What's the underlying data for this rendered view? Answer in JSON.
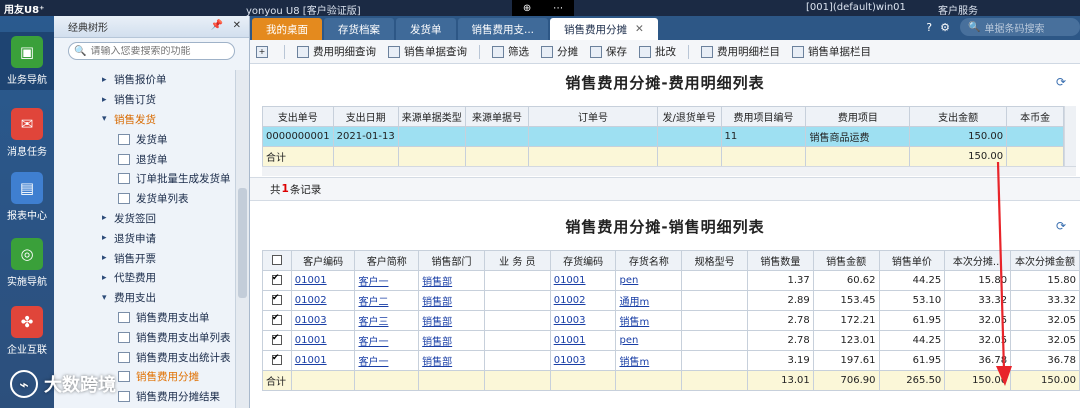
{
  "titlebar": {
    "brand": "用友U8⁺",
    "title": "yonyou U8 [客户验证版]",
    "account": "[001](default)win01",
    "service": "客户服务"
  },
  "iconbar": [
    {
      "label": "业务导航",
      "color": "#3aa03a",
      "glyph": "▣",
      "icon": "business-nav-icon"
    },
    {
      "label": "消息任务",
      "color": "#e0453a",
      "glyph": "✉",
      "icon": "message-icon"
    },
    {
      "label": "报表中心",
      "color": "#3f7fd0",
      "glyph": "▤",
      "icon": "report-icon"
    },
    {
      "label": "实施导航",
      "color": "#3aa03a",
      "glyph": "◎",
      "icon": "implement-nav-icon"
    },
    {
      "label": "企业互联",
      "color": "#e0453a",
      "glyph": "✤",
      "icon": "enterprise-icon"
    }
  ],
  "tree": {
    "header": "经典树形",
    "search_placeholder": "请输入您要搜索的功能",
    "items": [
      {
        "label": "销售报价单",
        "level": 1,
        "type": "arrow"
      },
      {
        "label": "销售订货",
        "level": 1,
        "type": "arrow"
      },
      {
        "label": "销售发货",
        "level": 1,
        "type": "open"
      },
      {
        "label": "发货单",
        "level": 2,
        "type": "doc"
      },
      {
        "label": "退货单",
        "level": 2,
        "type": "doc"
      },
      {
        "label": "订单批量生成发货单",
        "level": 2,
        "type": "doc"
      },
      {
        "label": "发货单列表",
        "level": 2,
        "type": "doc"
      },
      {
        "label": "发货签回",
        "level": 1,
        "type": "arrow"
      },
      {
        "label": "退货申请",
        "level": 1,
        "type": "arrow"
      },
      {
        "label": "销售开票",
        "level": 1,
        "type": "arrow"
      },
      {
        "label": "代垫费用",
        "level": 1,
        "type": "arrow"
      },
      {
        "label": "费用支出",
        "level": 1,
        "type": "open-plain"
      },
      {
        "label": "销售费用支出单",
        "level": 2,
        "type": "doc"
      },
      {
        "label": "销售费用支出单列表",
        "level": 2,
        "type": "doc"
      },
      {
        "label": "销售费用支出统计表",
        "level": 2,
        "type": "doc"
      },
      {
        "label": "销售费用分摊",
        "level": 2,
        "type": "doc-selected"
      },
      {
        "label": "销售费用分摊结果",
        "level": 2,
        "type": "doc"
      }
    ]
  },
  "tabs": [
    {
      "label": "我的桌面",
      "kind": "home"
    },
    {
      "label": "存货档案",
      "kind": "normal"
    },
    {
      "label": "发货单",
      "kind": "normal"
    },
    {
      "label": "销售费用支...",
      "kind": "normal"
    },
    {
      "label": "销售费用分摊",
      "kind": "active"
    }
  ],
  "header_search_placeholder": "单据条码搜索",
  "toolbar": [
    {
      "label": "费用明细查询",
      "icon": "search-doc-icon"
    },
    {
      "label": "销售单据查询",
      "icon": "search-doc-icon"
    },
    {
      "label": "筛选",
      "icon": "filter-icon"
    },
    {
      "label": "分摊",
      "icon": "split-icon"
    },
    {
      "label": "保存",
      "icon": "save-icon"
    },
    {
      "label": "批改",
      "icon": "batch-edit-icon"
    },
    {
      "label": "费用明细栏目",
      "icon": "columns-icon"
    },
    {
      "label": "销售单据栏目",
      "icon": "columns-icon"
    }
  ],
  "expense": {
    "title": "销售费用分摊-费用明细列表",
    "columns": [
      "支出单号",
      "支出日期",
      "来源单据类型",
      "来源单据号",
      "订单号",
      "发/退货单号",
      "费用项目编号",
      "费用项目",
      "支出金额",
      "本币金"
    ],
    "rows": [
      [
        "0000000001",
        "2021-01-13",
        "",
        "",
        "",
        "",
        "11",
        "销售商品运费",
        "150.00",
        ""
      ]
    ],
    "total_label": "合计",
    "total_amount": "150.00",
    "count_prefix": "共",
    "count": "1",
    "count_suffix": "条记录"
  },
  "sales": {
    "title": "销售费用分摊-销售明细列表",
    "columns": [
      "客户编码",
      "客户简称",
      "销售部门",
      "业 务 员",
      "存货编码",
      "存货名称",
      "规格型号",
      "销售数量",
      "销售金额",
      "销售单价",
      "本次分摊...",
      "本次分摊金额"
    ],
    "rows": [
      [
        "01001",
        "客户一",
        "销售部",
        "",
        "01001",
        "pen",
        "",
        "1.37",
        "60.62",
        "44.25",
        "15.80",
        "15.80"
      ],
      [
        "01002",
        "客户二",
        "销售部",
        "",
        "01002",
        "通用m",
        "",
        "2.89",
        "153.45",
        "53.10",
        "33.32",
        "33.32"
      ],
      [
        "01003",
        "客户三",
        "销售部",
        "",
        "01003",
        "销售m",
        "",
        "2.78",
        "172.21",
        "61.95",
        "32.05",
        "32.05"
      ],
      [
        "01001",
        "客户一",
        "销售部",
        "",
        "01001",
        "pen",
        "",
        "2.78",
        "123.01",
        "44.25",
        "32.05",
        "32.05"
      ],
      [
        "01001",
        "客户一",
        "销售部",
        "",
        "01003",
        "销售m",
        "",
        "3.19",
        "197.61",
        "61.95",
        "36.78",
        "36.78"
      ]
    ],
    "total_label": "合计",
    "totals": [
      "",
      "",
      "",
      "",
      "",
      "",
      "",
      "13.01",
      "706.90",
      "265.50",
      "150.00",
      "150.00"
    ]
  },
  "watermark": "大数跨境"
}
